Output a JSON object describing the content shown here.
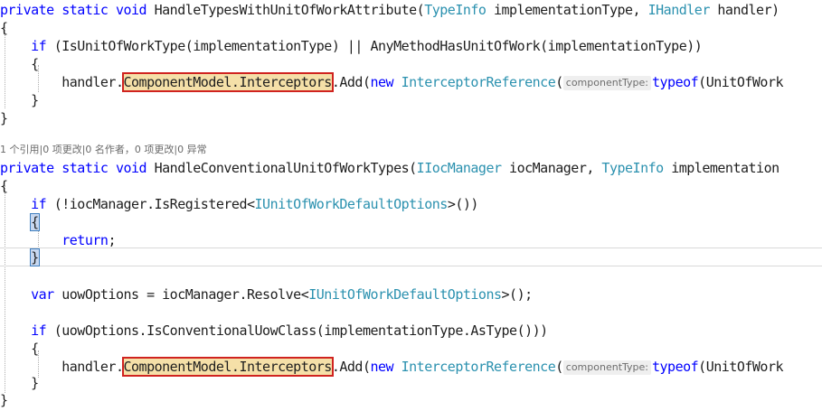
{
  "editor": {
    "accent_colors": {
      "keyword": "#0000ff",
      "type": "#2b91af",
      "highlight_border": "#d0231f"
    },
    "method1": {
      "kw_private": "private",
      "kw_static": "static",
      "kw_void": "void",
      "name": "HandleTypesWithUnitOfWorkAttribute(",
      "param1_type": "TypeInfo",
      "param1_name": " implementationType, ",
      "param2_type": "IHandler",
      "param2_name": " handler)",
      "open_brace": "{",
      "if_kw": "if",
      "if_cond": " (IsUnitOfWorkType(implementationType) || AnyMethodHasUnitOfWork(implementationType))",
      "if_open": "{",
      "stmt_prefix": "handler.",
      "stmt_highlight": "ComponentModel.Interceptors",
      "stmt_add": ".Add(",
      "stmt_new": "new",
      "stmt_ref_type": "InterceptorReference",
      "stmt_paren": "(",
      "hint": "componentType:",
      "stmt_typeof": "typeof",
      "stmt_tail": "(UnitOfWork",
      "if_close": "}",
      "close_brace": "}"
    },
    "codelens": "1 个引用|0 项更改|0 名作者，0 项更改|0 异常",
    "method2": {
      "kw_private": "private",
      "kw_static": "static",
      "kw_void": "void",
      "name": "HandleConventionalUnitOfWorkTypes(",
      "param1_type": "IIocManager",
      "param1_name": " iocManager, ",
      "param2_type": "TypeInfo",
      "param2_name": " implementation",
      "open_brace": "{",
      "if1_kw": "if",
      "if1_cond_a": " (!iocManager.IsRegistered<",
      "if1_generic": "IUnitOfWorkDefaultOptions",
      "if1_cond_b": ">())",
      "if1_open": "{",
      "return_kw": "return",
      "return_semi": ";",
      "if1_close": "}",
      "var_kw": "var",
      "var_decl_a": " uowOptions = iocManager.Resolve<",
      "var_generic": "IUnitOfWorkDefaultOptions",
      "var_decl_b": ">();",
      "if2_kw": "if",
      "if2_cond": " (uowOptions.IsConventionalUowClass(implementationType.AsType()))",
      "if2_open": "{",
      "stmt_prefix": "handler.",
      "stmt_highlight": "ComponentModel.Interceptors",
      "stmt_add": ".Add(",
      "stmt_new": "new",
      "stmt_ref_type": "InterceptorReference",
      "stmt_paren": "(",
      "hint": "componentType:",
      "stmt_typeof": "typeof",
      "stmt_tail": "(UnitOfWork",
      "if2_close": "}",
      "close_brace": "}"
    }
  }
}
